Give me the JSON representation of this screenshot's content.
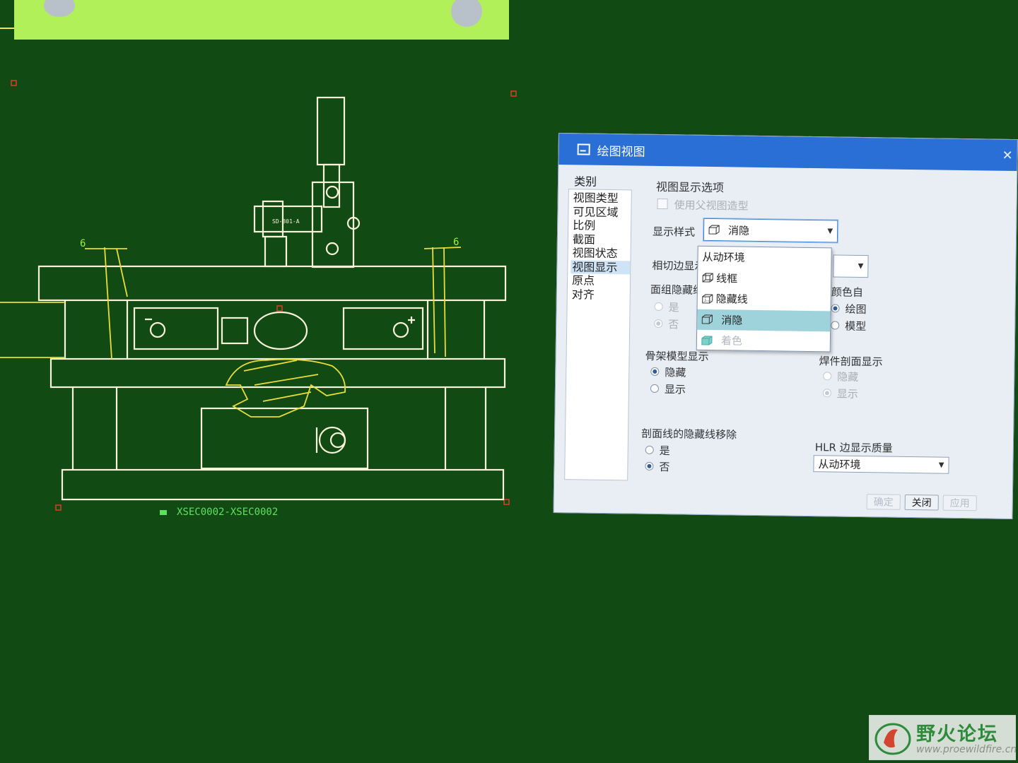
{
  "drawing": {
    "view_caption": "XSEC0002-XSEC0002",
    "dimension_left": "6",
    "dimension_right": "6",
    "part_label": "SD-301-A"
  },
  "dialog": {
    "title": "绘图视图",
    "close_glyph": "✕",
    "category_label": "类别",
    "categories": [
      "视图类型",
      "可见区域",
      "比例",
      "截面",
      "视图状态",
      "视图显示",
      "原点",
      "对齐"
    ],
    "selected_category": "视图显示",
    "section_title": "视图显示选项",
    "use_parent_label": "使用父视图造型",
    "display_style_label": "显示样式",
    "display_style_value": "消隐",
    "display_style_options": [
      {
        "label": "从动环境",
        "icon": ""
      },
      {
        "label": "线框",
        "icon": "wireframe-cube-icon"
      },
      {
        "label": "隐藏线",
        "icon": "hidden-line-cube-icon"
      },
      {
        "label": "消隐",
        "icon": "no-hidden-cube-icon",
        "selected": true
      },
      {
        "label": "着色",
        "icon": "shaded-cube-icon",
        "disabled": true
      }
    ],
    "tangent_edge_label": "相切边显示",
    "quilt_hidden_label": "面组隐藏线",
    "quilt_yes": "是",
    "quilt_no": "否",
    "color_from_label": "颜色自",
    "color_drawing": "绘图",
    "color_model": "模型",
    "skeleton_label": "骨架模型显示",
    "skeleton_hide": "隐藏",
    "skeleton_show": "显示",
    "weld_label": "焊件剖面显示",
    "weld_hide": "隐藏",
    "weld_show": "显示",
    "section_hidden_label": "剖面线的隐藏线移除",
    "section_yes": "是",
    "section_no": "否",
    "hlr_label": "HLR 边显示质量",
    "hlr_value": "从动环境",
    "btn_ok": "确定",
    "btn_close": "关闭",
    "btn_apply": "应用"
  },
  "watermark": {
    "title": "野火论坛",
    "url": "www.proewildfire.cn"
  }
}
